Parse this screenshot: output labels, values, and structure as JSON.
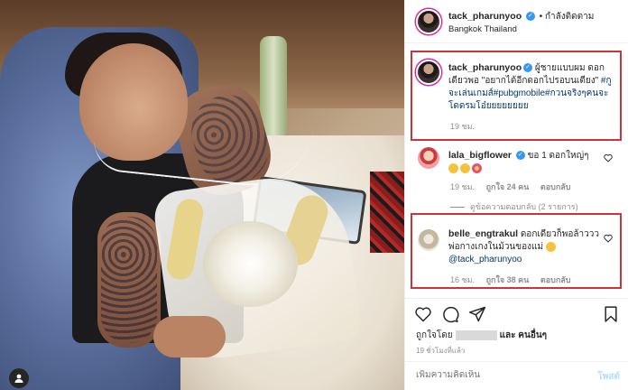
{
  "post": {
    "username": "tack_pharunyoo",
    "follow_label": "• กำลังติดตาม",
    "location": "Bangkok Thailand",
    "caption_user": "tack_pharunyoo",
    "caption_text": "ผู้ชายแบบผม ดอกเดียวพอ \"อยากได้อีกดอกไปรอบนเตียง\"",
    "caption_hashtags": "#กูจะเล่นเกมส์#pubgmobile#กวนจริงๆคนจะโดดรมโอ๋ยยยยยยยย",
    "caption_time": "19 ชม."
  },
  "comments": [
    {
      "user": "lala_bigflower",
      "text": "ขอ 1 ดอกใหญ่ๆ",
      "emojis": [
        "laugh-emoji",
        "laugh-emoji",
        "flower-emoji"
      ],
      "time": "19 ชม.",
      "likes": "ถูกใจ 24 คน",
      "reply": "ตอบกลับ"
    },
    {
      "user": "belle_engtrakul",
      "text": "ดอกเดียวก็พอล้าววว พ่อกางเกงในม้วนของแม่",
      "emojis": [
        "laugh-emoji"
      ],
      "mention": "@tack_pharunyoo",
      "time": "16 ชม.",
      "likes": "ถูกใจ 38 คน",
      "reply": "ตอบกลับ"
    }
  ],
  "view_replies": "ดูข้อความตอบกลับ (2 รายการ)",
  "likes_prefix": "ถูกใจโดย",
  "likes_suffix": "และ คนอื่นๆ",
  "post_time": "19 ชั่วโมงที่แล้ว",
  "comment_placeholder": "เพิ่มความคิดเห็น",
  "post_button": "โพสต์",
  "icons": {
    "like": "heart-icon",
    "comment": "comment-icon",
    "share": "share-icon",
    "save": "bookmark-icon",
    "verified": "verified-icon",
    "user": "user-tag-icon"
  },
  "colors": {
    "highlight_border": "#c9353b",
    "verified": "#3897f0",
    "link": "#00376b",
    "muted": "#8e8e8e"
  }
}
